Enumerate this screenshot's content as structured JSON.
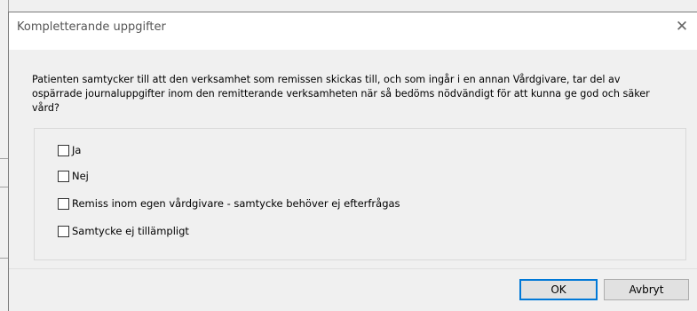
{
  "dialog": {
    "title": "Kompletterande uppgifter",
    "close_glyph": "✕",
    "question": "Patienten samtycker till att den verksamhet som remissen skickas till, och som ingår i en annan Vårdgivare, tar del av ospärrade journaluppgifter inom den remitterande verksamheten när så bedöms nödvändigt för att kunna ge god och säker vård?",
    "options": [
      {
        "label": "Ja",
        "checked": false
      },
      {
        "label": "Nej",
        "checked": false
      },
      {
        "label": "Remiss inom egen vårdgivare - samtycke behöver ej efterfrågas",
        "checked": false
      },
      {
        "label": "Samtycke ej tillämpligt",
        "checked": false
      }
    ],
    "ok_label": "OK",
    "cancel_label": "Avbryt"
  }
}
